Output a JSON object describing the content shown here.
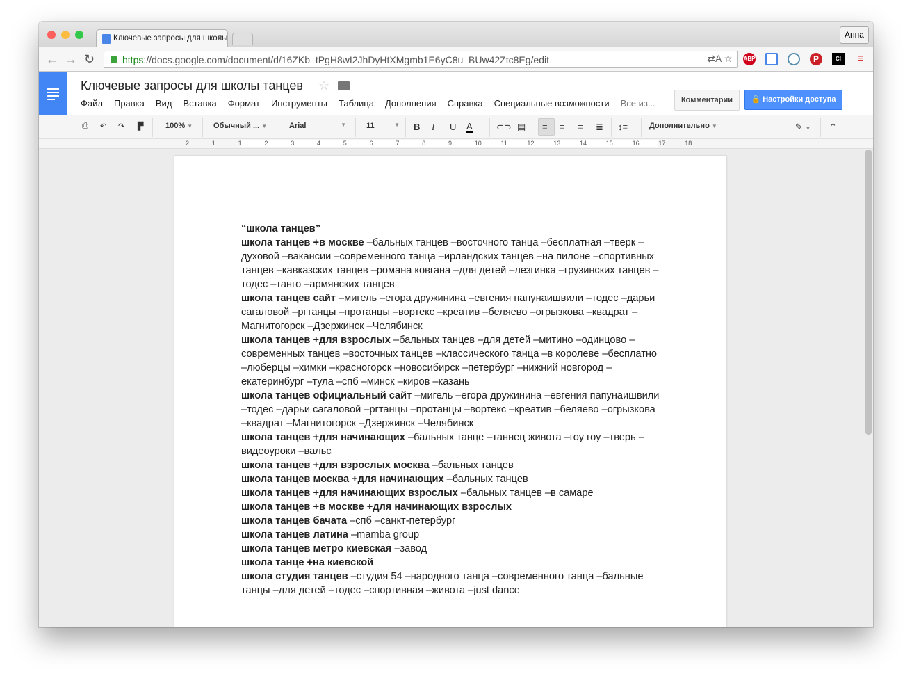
{
  "browser": {
    "tab_title": "Ключевые запросы для школы танцев",
    "user": "Анна",
    "url_scheme": "https",
    "url_rest": "://docs.google.com/document/d/16ZKb_tPgH8wI2JhDyHtXMgmb1E6yC8u_BUw42Ztc8Eg/edit",
    "ext_abp": "ABP",
    "ext_ci": "CI"
  },
  "doc": {
    "title": "Ключевые запросы для школы танцев",
    "menu": [
      "Файл",
      "Правка",
      "Вид",
      "Вставка",
      "Формат",
      "Инструменты",
      "Таблица",
      "Дополнения",
      "Справка",
      "Специальные возможности"
    ],
    "last_edit": "Все из...",
    "comments": "Комментарии",
    "share": "Настройки доступа"
  },
  "toolbar": {
    "zoom": "100%",
    "style": "Обычный ...",
    "font": "Arial",
    "size": "11",
    "more": "Дополнительно",
    "bold": "B",
    "italic": "I",
    "underline": "U",
    "color": "A"
  },
  "ruler": [
    "2",
    "1",
    "1",
    "2",
    "3",
    "4",
    "5",
    "6",
    "7",
    "8",
    "9",
    "10",
    "11",
    "12",
    "13",
    "14",
    "15",
    "16",
    "17",
    "18"
  ],
  "paragraphs": [
    {
      "b": "“школа танцев”",
      "t": ""
    },
    {
      "b": "школа танцев +в москве",
      "t": " –бальных танцев –восточного танца –бесплатная –тверк –духовой –вакансии –современного танца –ирландских танцев –на пилоне –спортивных танцев –кавказских танцев –романа ковгана –для детей –лезгинка –грузинских танцев –тодес –танго –армянских танцев"
    },
    {
      "b": "школа танцев сайт",
      "t": " –мигель –егора дружинина –евгения папунаишвили –тодес –дарьи сагаловой –ргтанцы  –протанцы –вортекс –креатив –беляево –огрызкова –квадрат –Магнитогорск –Дзержинск –Челябинск"
    },
    {
      "b": "школа танцев +для взрослых",
      "t": " –бальных танцев –для детей –митино –одинцово –современных танцев –восточных танцев –классического танца –в королеве –бесплатно –люберцы –химки –красногорск –новосибирск –петербург –нижний новгород –екатеринбург –тула –спб –минск –киров –казань"
    },
    {
      "b": "школа танцев официальный сайт",
      "t": " –мигель –егора дружинина –евгения папунаишвили –тодес –дарьи сагаловой –ргтанцы –протанцы –вортекс –креатив –беляево –огрызкова –квадрат –Магнитогорск –Дзержинск –Челябинск"
    },
    {
      "b": "школа танцев +для начинающих",
      "t": " –бальных танце –таннец живота –гоу гоу –тверь –видеоуроки –вальс"
    },
    {
      "b": "школа танцев +для взрослых москва",
      "t": " –бальных танцев"
    },
    {
      "b": "школа танцев москва +для начинающих",
      "t": " –бальных танцев"
    },
    {
      "b": "школа танцев +для начинающих взрослых",
      "t": " –бальных танцев –в самаре"
    },
    {
      "b": "школа танцев +в москве +для начинающих взрослых",
      "t": ""
    },
    {
      "b": "школа танцев бачата",
      "t": " –спб –санкт-петербург"
    },
    {
      "b": "школа танцев латина",
      "t": " –mamba group"
    },
    {
      "b": "школа танцев метро киевская",
      "t": " –завод"
    },
    {
      "b": "школа танце +на киевской",
      "t": ""
    },
    {
      "b": "школа студия танцев",
      "t": " –студия 54 –народного танца –современного танца –бальные танцы –для детей –тодес –спортивная –живота –just dance"
    }
  ]
}
